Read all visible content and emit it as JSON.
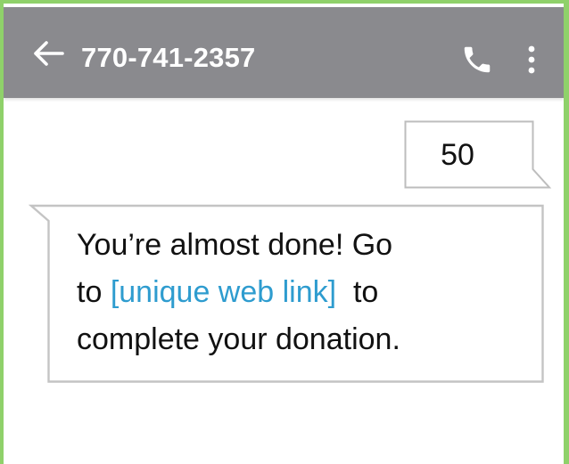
{
  "header": {
    "title": "770-741-2357",
    "background_color": "#8a8a8e",
    "icons": {
      "back": "arrow-left-icon",
      "call": "phone-icon",
      "more": "more-vert-icon"
    }
  },
  "conversation": {
    "outgoing_message": {
      "text": "50"
    },
    "incoming_message": {
      "line1": "You’re almost done! Go",
      "line2_prefix": "to ",
      "link_text": "[unique web link]",
      "line2_suffix": "  to",
      "line3": "complete your donation."
    },
    "link_color": "#2e9ccf"
  },
  "page_border_color": "#8fd16a"
}
